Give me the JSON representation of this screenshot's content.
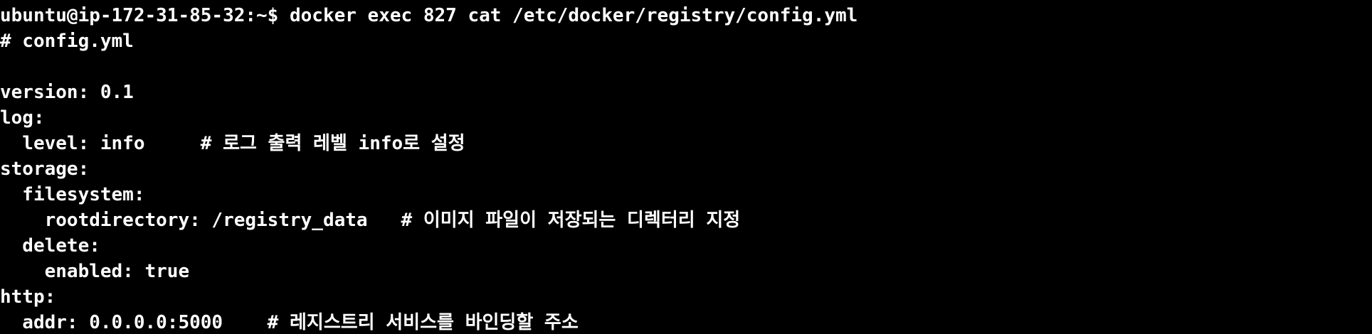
{
  "terminal": {
    "background": "#000000",
    "foreground": "#ffffff",
    "lines": [
      "ubuntu@ip-172-31-85-32:~$ docker exec 827 cat /etc/docker/registry/config.yml",
      "# config.yml",
      "",
      "version: 0.1",
      "log:",
      "  level: info     # 로그 출력 레벨 info로 설정",
      "storage:",
      "  filesystem:",
      "    rootdirectory: /registry_data   # 이미지 파일이 저장되는 디렉터리 지정",
      "  delete:",
      "    enabled: true",
      "http:",
      "  addr: 0.0.0.0:5000    # 레지스트리 서비스를 바인딩할 주소"
    ]
  }
}
